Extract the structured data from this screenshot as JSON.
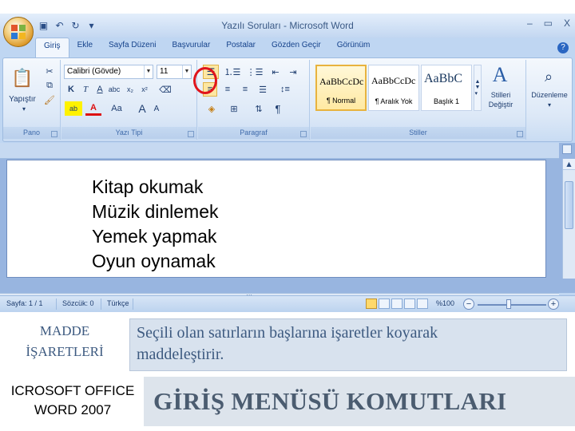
{
  "window": {
    "title": "Yazılı Soruları - Microsoft Word",
    "controls": [
      "–",
      "▭",
      "X"
    ]
  },
  "quick_access": [
    "save-icon",
    "undo-icon",
    "redo-icon"
  ],
  "ribbon_tabs": [
    {
      "label": "Giriş",
      "active": true
    },
    {
      "label": "Ekle"
    },
    {
      "label": "Sayfa Düzeni"
    },
    {
      "label": "Başvurular"
    },
    {
      "label": "Postalar"
    },
    {
      "label": "Gözden Geçir"
    },
    {
      "label": "Görünüm"
    }
  ],
  "ribbon": {
    "pano": {
      "label": "Pano",
      "paste_label": "Yapıştır"
    },
    "font": {
      "label": "Yazı Tipi",
      "font_name": "Calibri (Gövde)",
      "font_size": "11",
      "buttons": [
        "K",
        "T",
        "A",
        "Aa",
        "A",
        "A"
      ]
    },
    "paragraph": {
      "label": "Paragraf"
    },
    "styles": {
      "label": "Stiller",
      "items": [
        {
          "sample": "AaBbCcDc",
          "name": "¶ Normal",
          "selected": true
        },
        {
          "sample": "AaBbCcDc",
          "name": "¶ Aralık Yok"
        },
        {
          "sample": "AaBbC",
          "name": "Başlık 1"
        }
      ],
      "change_label_1": "Stilleri",
      "change_label_2": "Değiştir"
    },
    "editing": {
      "label": "Düzenleme"
    }
  },
  "document": {
    "lines": [
      "Kitap okumak",
      "Müzik dinlemek",
      "Yemek yapmak",
      "Oyun oynamak"
    ]
  },
  "status": {
    "page": "Sayfa: 1 / 1",
    "words": "Sözcük: 0",
    "language": "Türkçe",
    "zoom": "%100"
  },
  "slide": {
    "term_line1": "MADDE",
    "term_line2": "İŞARETLERİ",
    "description_line1": "Seçili olan satırların başlarına işaretler koyarak",
    "description_line2": "maddeleştirir.",
    "product_line1": "ICROSOFT OFFICE",
    "product_line2": "WORD 2007",
    "heading": "GİRİŞ MENÜSÜ KOMUTLARI"
  },
  "colors": {
    "highlight_circle": "#e0141c",
    "ribbon_bg": "#dce8f7",
    "heading_text": "#4b5c70"
  }
}
